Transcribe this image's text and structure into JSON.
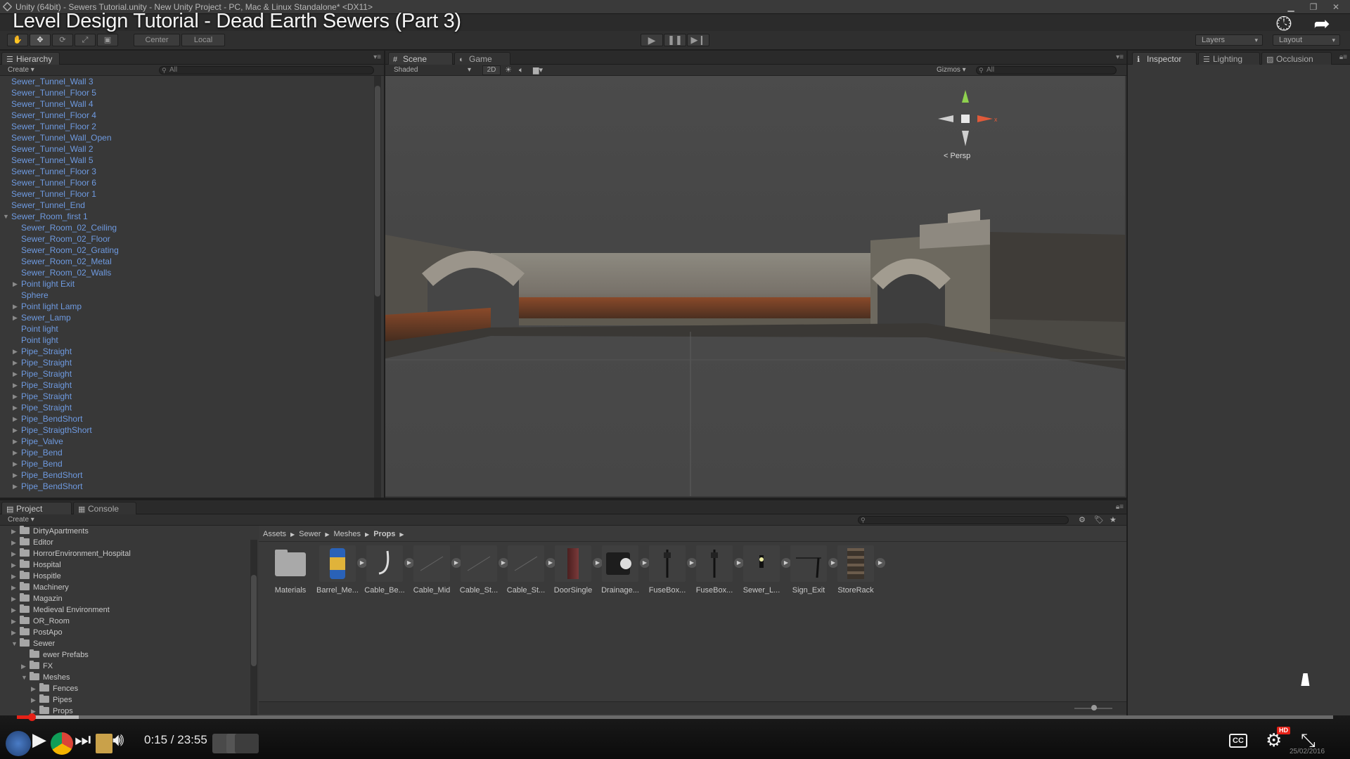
{
  "window": {
    "title": "Unity (64bit) - Sewers Tutorial.unity - New Unity Project - PC, Mac & Linux Standalone* <DX11>"
  },
  "video": {
    "title": "Level Design Tutorial - Dead Earth Sewers (Part 3)",
    "current_time": "0:15",
    "duration": "23:55",
    "time_display": "0:15 / 23:55",
    "progress_fraction": 0.0105,
    "hd_badge": "HD",
    "cc_label": "CC",
    "date": "25/02/2016"
  },
  "toolbar": {
    "pivot_label": "Center",
    "space_label": "Local",
    "layers_label": "Layers",
    "layout_label": "Layout"
  },
  "hierarchy": {
    "tab_label": "Hierarchy",
    "create_label": "Create",
    "search_placeholder": "All",
    "items": [
      {
        "label": "Sewer_Tunnel_Wall 3",
        "indent": 0,
        "expand": ""
      },
      {
        "label": "Sewer_Tunnel_Floor 5",
        "indent": 0,
        "expand": ""
      },
      {
        "label": "Sewer_Tunnel_Wall 4",
        "indent": 0,
        "expand": ""
      },
      {
        "label": "Sewer_Tunnel_Floor 4",
        "indent": 0,
        "expand": ""
      },
      {
        "label": "Sewer_Tunnel_Floor 2",
        "indent": 0,
        "expand": ""
      },
      {
        "label": "Sewer_Tunnel_Wall_Open",
        "indent": 0,
        "expand": ""
      },
      {
        "label": "Sewer_Tunnel_Wall 2",
        "indent": 0,
        "expand": ""
      },
      {
        "label": "Sewer_Tunnel_Wall 5",
        "indent": 0,
        "expand": ""
      },
      {
        "label": "Sewer_Tunnel_Floor 3",
        "indent": 0,
        "expand": ""
      },
      {
        "label": "Sewer_Tunnel_Floor 6",
        "indent": 0,
        "expand": ""
      },
      {
        "label": "Sewer_Tunnel_Floor 1",
        "indent": 0,
        "expand": ""
      },
      {
        "label": "Sewer_Tunnel_End",
        "indent": 0,
        "expand": ""
      },
      {
        "label": "Sewer_Room_first 1",
        "indent": 0,
        "expand": "▼"
      },
      {
        "label": "Sewer_Room_02_Ceiling",
        "indent": 1,
        "expand": ""
      },
      {
        "label": "Sewer_Room_02_Floor",
        "indent": 1,
        "expand": ""
      },
      {
        "label": "Sewer_Room_02_Grating",
        "indent": 1,
        "expand": ""
      },
      {
        "label": "Sewer_Room_02_Metal",
        "indent": 1,
        "expand": ""
      },
      {
        "label": "Sewer_Room_02_Walls",
        "indent": 1,
        "expand": ""
      },
      {
        "label": "Point light Exit",
        "indent": 1,
        "expand": "▶"
      },
      {
        "label": "Sphere",
        "indent": 1,
        "expand": ""
      },
      {
        "label": "Point light Lamp",
        "indent": 1,
        "expand": "▶"
      },
      {
        "label": "Sewer_Lamp",
        "indent": 1,
        "expand": "▶"
      },
      {
        "label": "Point light",
        "indent": 1,
        "expand": ""
      },
      {
        "label": "Point light",
        "indent": 1,
        "expand": ""
      },
      {
        "label": "Pipe_Straight",
        "indent": 1,
        "expand": "▶"
      },
      {
        "label": "Pipe_Straight",
        "indent": 1,
        "expand": "▶"
      },
      {
        "label": "Pipe_Straight",
        "indent": 1,
        "expand": "▶"
      },
      {
        "label": "Pipe_Straight",
        "indent": 1,
        "expand": "▶"
      },
      {
        "label": "Pipe_Straight",
        "indent": 1,
        "expand": "▶"
      },
      {
        "label": "Pipe_Straight",
        "indent": 1,
        "expand": "▶"
      },
      {
        "label": "Pipe_BendShort",
        "indent": 1,
        "expand": "▶"
      },
      {
        "label": "Pipe_StraigthShort",
        "indent": 1,
        "expand": "▶"
      },
      {
        "label": "Pipe_Valve",
        "indent": 1,
        "expand": "▶"
      },
      {
        "label": "Pipe_Bend",
        "indent": 1,
        "expand": "▶"
      },
      {
        "label": "Pipe_Bend",
        "indent": 1,
        "expand": "▶"
      },
      {
        "label": "Pipe_BendShort",
        "indent": 1,
        "expand": "▶"
      },
      {
        "label": "Pipe_BendShort",
        "indent": 1,
        "expand": "▶"
      }
    ]
  },
  "scene": {
    "tab_scene": "Scene",
    "tab_game": "Game",
    "shading_mode": "Shaded",
    "mode_2d": "2D",
    "gizmos_label": "Gizmos",
    "search_placeholder": "All",
    "projection_label": "Persp"
  },
  "inspector": {
    "tab_inspector": "Inspector",
    "tab_lighting": "Lighting",
    "tab_occlusion": "Occlusion"
  },
  "project": {
    "tab_project": "Project",
    "tab_console": "Console",
    "create_label": "Create",
    "breadcrumb": [
      "Assets",
      "Sewer",
      "Meshes",
      "Props"
    ],
    "folders": [
      {
        "label": "DirtyApartments",
        "depth": 0,
        "expand": "▶"
      },
      {
        "label": "Editor",
        "depth": 0,
        "expand": "▶"
      },
      {
        "label": "HorrorEnvironment_Hospital",
        "depth": 0,
        "expand": "▶"
      },
      {
        "label": "Hospital",
        "depth": 0,
        "expand": "▶"
      },
      {
        "label": "Hospitle",
        "depth": 0,
        "expand": "▶"
      },
      {
        "label": "Machinery",
        "depth": 0,
        "expand": "▶"
      },
      {
        "label": "Magazin",
        "depth": 0,
        "expand": "▶"
      },
      {
        "label": "Medieval Environment",
        "depth": 0,
        "expand": "▶"
      },
      {
        "label": "OR_Room",
        "depth": 0,
        "expand": "▶"
      },
      {
        "label": "PostApo",
        "depth": 0,
        "expand": "▶"
      },
      {
        "label": "Sewer",
        "depth": 0,
        "expand": "▼"
      },
      {
        "label": "ewer Prefabs",
        "depth": 1,
        "expand": ""
      },
      {
        "label": "FX",
        "depth": 1,
        "expand": "▶"
      },
      {
        "label": "Meshes",
        "depth": 1,
        "expand": "▼"
      },
      {
        "label": "Fences",
        "depth": 2,
        "expand": "▶"
      },
      {
        "label": "Pipes",
        "depth": 2,
        "expand": "▶"
      },
      {
        "label": "Props",
        "depth": 2,
        "expand": "▶"
      }
    ],
    "assets": [
      {
        "label": "Materials",
        "kind": "folder"
      },
      {
        "label": "Barrel_Me...",
        "kind": "barrel"
      },
      {
        "label": "Cable_Be...",
        "kind": "cable-bend"
      },
      {
        "label": "Cable_Mid",
        "kind": "cable"
      },
      {
        "label": "Cable_St...",
        "kind": "cable"
      },
      {
        "label": "Cable_St...",
        "kind": "cable"
      },
      {
        "label": "DoorSingle",
        "kind": "door"
      },
      {
        "label": "Drainage...",
        "kind": "drainage"
      },
      {
        "label": "FuseBox...",
        "kind": "fuse"
      },
      {
        "label": "FuseBox...",
        "kind": "fuse"
      },
      {
        "label": "Sewer_L...",
        "kind": "lamp"
      },
      {
        "label": "Sign_Exit",
        "kind": "sign"
      },
      {
        "label": "StoreRack",
        "kind": "rack"
      }
    ]
  },
  "colors": {
    "editor_bg": "#383838",
    "hierarchy_text": "#6e9ae0",
    "progress_red": "#e62117"
  }
}
